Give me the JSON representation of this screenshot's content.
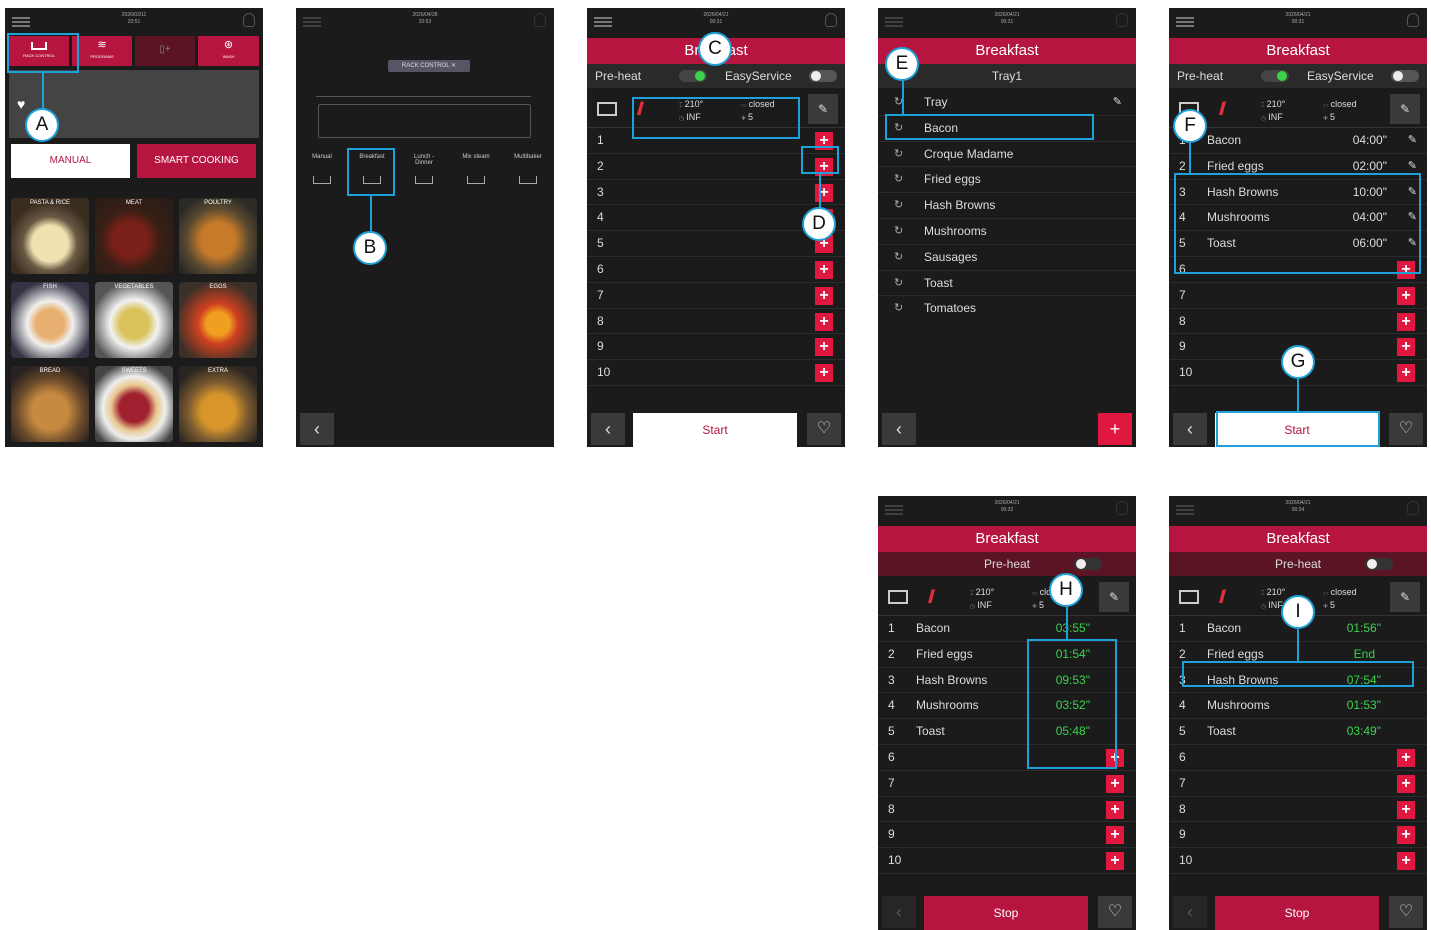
{
  "colors": {
    "brand": "#b5153e",
    "timer_green": "#3bd24c",
    "callout": "#1ea0d8",
    "plus": "#e0173e"
  },
  "callouts": [
    "A",
    "B",
    "C",
    "D",
    "E",
    "F",
    "G",
    "H",
    "I"
  ],
  "screen1": {
    "date": "2026/03/11",
    "time": "20:51",
    "tabs": [
      {
        "label": "RACK CONTROL"
      },
      {
        "label": "PROGRAMS"
      },
      {
        "label": ""
      },
      {
        "label": "WASH"
      }
    ],
    "manual_label": "MANUAL",
    "smart_label": "SMART COOKING",
    "categories": [
      "PASTA & RICE",
      "MEAT",
      "POULTRY",
      "FISH",
      "VEGETABLES",
      "EGGS",
      "BREAD",
      "SWEETS",
      "EXTRA"
    ]
  },
  "screen2": {
    "date": "2026/04/28",
    "time": "20:53",
    "chip": "RACK CONTROL",
    "modes": [
      "Manual",
      "Breakfast",
      "Lunch - Dinner",
      "Mix steam",
      "Multibaker"
    ]
  },
  "screen3": {
    "date": "2026/04/21",
    "time": "00:31",
    "title": "Breakfast",
    "preheat": "Pre-heat",
    "easyservice": "EasyService",
    "temp": "210°",
    "time_val": "INF",
    "door": "closed",
    "level": "5",
    "rows": [
      "1",
      "2",
      "3",
      "4",
      "5",
      "6",
      "7",
      "8",
      "9",
      "10"
    ],
    "start": "Start"
  },
  "screen4": {
    "date": "2026/04/21",
    "time": "00:31",
    "title": "Breakfast",
    "sub": "Tray1",
    "recipes": [
      "Tray",
      "Bacon",
      "Croque Madame",
      "Fried eggs",
      "Hash Browns",
      "Mushrooms",
      "Sausages",
      "Toast",
      "Tomatoes"
    ]
  },
  "screen5": {
    "date": "2026/04/21",
    "time": "00:31",
    "title": "Breakfast",
    "preheat": "Pre-heat",
    "easyservice": "EasyService",
    "temp": "210°",
    "time_val": "INF",
    "door": "closed",
    "level": "5",
    "items": [
      {
        "n": "1",
        "name": "Bacon",
        "time": "04:00\""
      },
      {
        "n": "2",
        "name": "Fried eggs",
        "time": "02:00\""
      },
      {
        "n": "3",
        "name": "Hash Browns",
        "time": "10:00\""
      },
      {
        "n": "4",
        "name": "Mushrooms",
        "time": "04:00\""
      },
      {
        "n": "5",
        "name": "Toast",
        "time": "06:00\""
      }
    ],
    "empty_rows": [
      "6",
      "7",
      "8",
      "9",
      "10"
    ],
    "start": "Start"
  },
  "screen6": {
    "date": "2026/04/21",
    "time": "00:32",
    "title": "Breakfast",
    "preheat": "Pre-heat",
    "temp": "210°",
    "time_val": "INF",
    "door": "closed",
    "level": "5",
    "items": [
      {
        "n": "1",
        "name": "Bacon",
        "time": "03:55\""
      },
      {
        "n": "2",
        "name": "Fried eggs",
        "time": "01:54\""
      },
      {
        "n": "3",
        "name": "Hash Browns",
        "time": "09:53\""
      },
      {
        "n": "4",
        "name": "Mushrooms",
        "time": "03:52\""
      },
      {
        "n": "5",
        "name": "Toast",
        "time": "05:48\""
      }
    ],
    "empty_rows": [
      "6",
      "7",
      "8",
      "9",
      "10"
    ],
    "stop": "Stop"
  },
  "screen7": {
    "date": "2026/04/21",
    "time": "00:34",
    "title": "Breakfast",
    "preheat": "Pre-heat",
    "temp": "210°",
    "time_val": "INF",
    "door": "closed",
    "level": "5",
    "items": [
      {
        "n": "1",
        "name": "Bacon",
        "time": "01:56\""
      },
      {
        "n": "2",
        "name": "Fried eggs",
        "time": "End"
      },
      {
        "n": "3",
        "name": "Hash Browns",
        "time": "07:54\""
      },
      {
        "n": "4",
        "name": "Mushrooms",
        "time": "01:53\""
      },
      {
        "n": "5",
        "name": "Toast",
        "time": "03:49\""
      }
    ],
    "empty_rows": [
      "6",
      "7",
      "8",
      "9",
      "10"
    ],
    "stop": "Stop"
  }
}
